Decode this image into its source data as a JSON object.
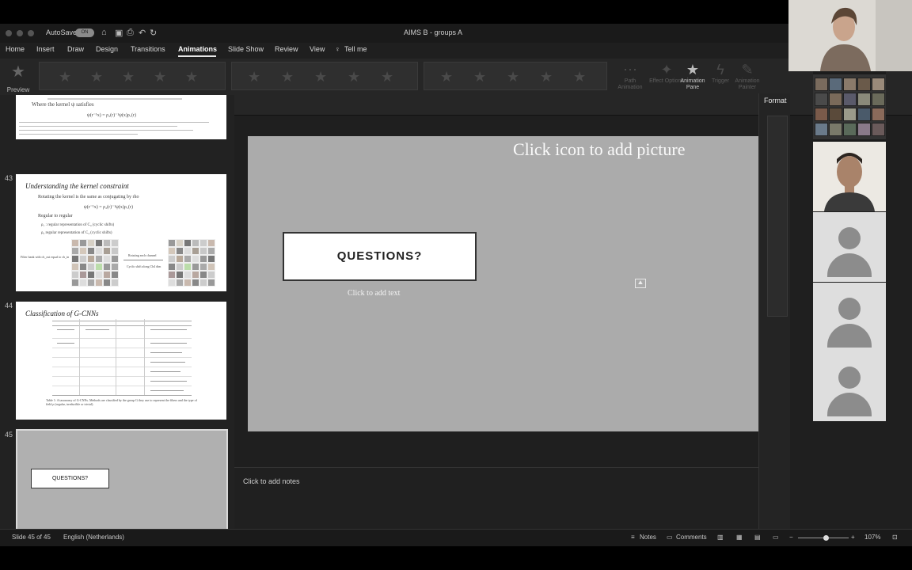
{
  "title_bar": {
    "autosave_label": "AutoSave",
    "autosave_state": "ON",
    "document_title": "AIMS B - groups A",
    "icons": [
      "home-icon",
      "save-icon",
      "print-icon",
      "undo-icon",
      "redo-icon"
    ]
  },
  "tabs": [
    "Home",
    "Insert",
    "Draw",
    "Design",
    "Transitions",
    "Animations",
    "Slide Show",
    "Review",
    "View",
    "Tell me"
  ],
  "active_tab": "Animations",
  "ribbon": {
    "preview_label": "Preview",
    "path_animation": "Path Animation",
    "effect_options": "Effect Options",
    "animation_pane": "Animation Pane",
    "trigger": "Trigger",
    "animation_painter": "Animation Painter"
  },
  "thumbnails": {
    "slide42": {
      "lines": [
        "Where the kernel ψ satisfies",
        "ψ(r⁻¹x) = ρ₂(r)⁻¹ψ(x)ρ₁(r)"
      ]
    },
    "slide43": {
      "number": "43",
      "title": "Understanding the kernel constraint",
      "lines": [
        "Rotating the kernel is the same as conjugating by rho",
        "ψ(r⁻¹x) = ρ₂(r)⁻¹ψ(x)ρ₁(r)",
        "Regular to regular",
        "ρ₁ : regular representation of C₄ (cyclic shifts)",
        "ρ₂ regular representation of C₄ (cyclic shifts)"
      ],
      "left_caption": "Filter bank with ch_out equal to ch_in",
      "arrow_top": "Rotating each channel",
      "arrow_bottom": "Cyclic shift along Ch4 dim"
    },
    "slide44": {
      "number": "44",
      "title": "Classification of G-CNNs",
      "caption": "Table 1: A taxonomy of G-CNNs. Methods are classified by the group G they use to represent the fibers and the type of field ρ (regular, irreducible or trivial)."
    },
    "slide45": {
      "number": "45",
      "box_label": "QUESTIONS?"
    }
  },
  "slide": {
    "picture_placeholder": "Click icon to add picture",
    "questions": "QUESTIONS?",
    "text_placeholder": "Click to add text"
  },
  "notes_placeholder": "Click to add notes",
  "format_pane_title": "Format",
  "status_bar": {
    "slide_counter": "Slide 45 of 45",
    "language": "English (Netherlands)",
    "notes": "Notes",
    "comments": "Comments",
    "zoom": "107%",
    "zoom_fraction": 0.55
  }
}
